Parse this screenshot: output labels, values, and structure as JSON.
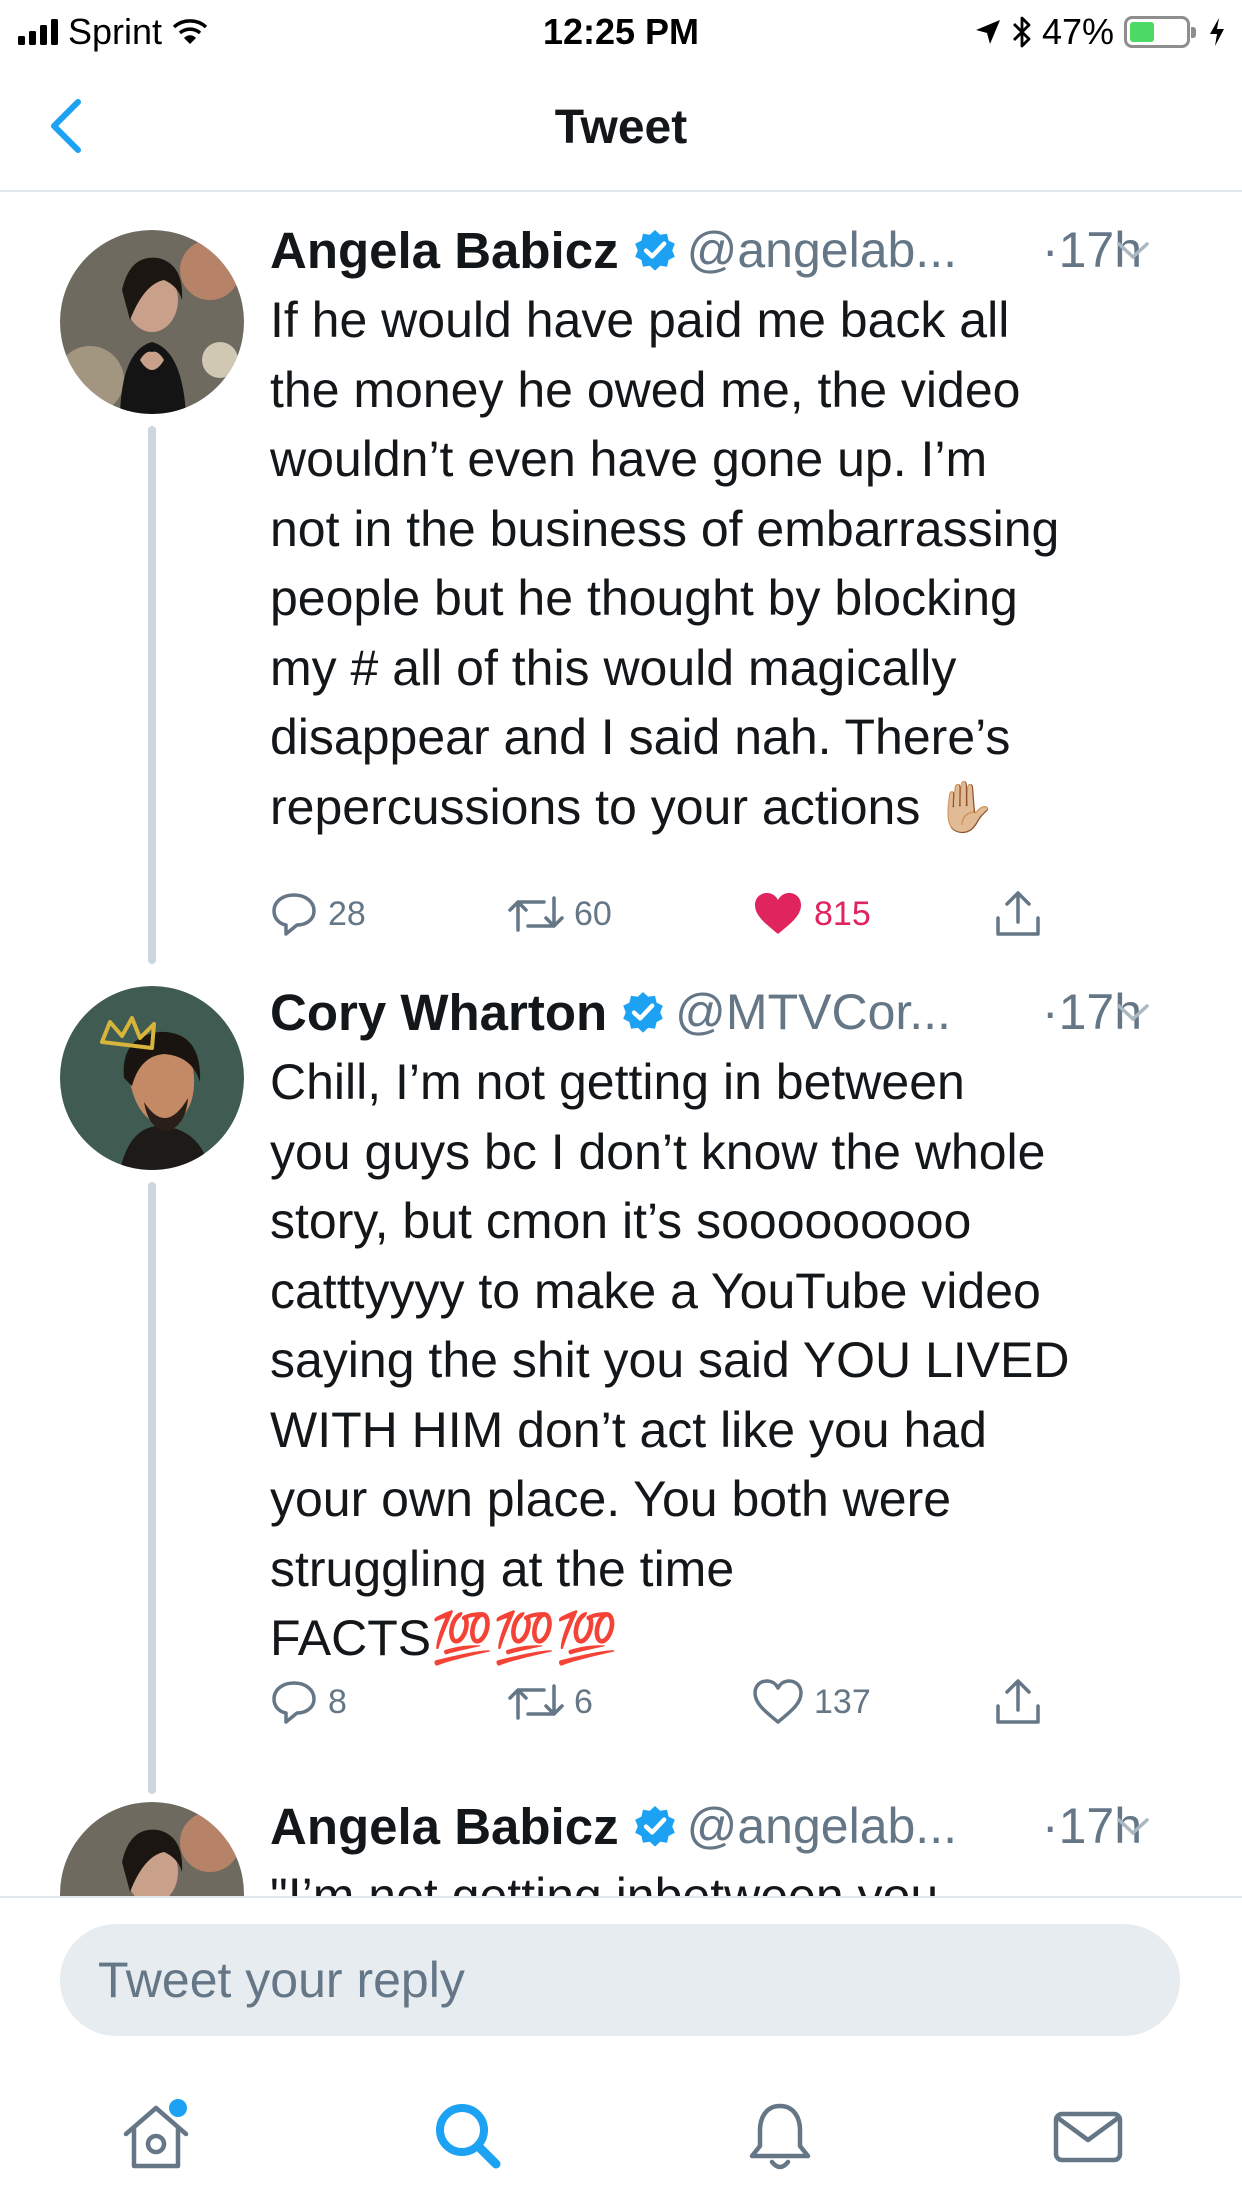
{
  "status_bar": {
    "carrier": "Sprint",
    "time": "12:25 PM",
    "battery_percent": "47%",
    "battery_level": 0.47
  },
  "nav": {
    "title": "Tweet",
    "back_icon": "chevron-left-icon"
  },
  "tweets": [
    {
      "name": "Angela Babicz",
      "handle": "@angelab...",
      "time": "·17h",
      "verified": true,
      "text": "If he would have paid me back all\nthe money he owed me, the video\nwouldn’t even have gone up. I’m\nnot in the business of embarrassing\npeople but he thought by blocking\nmy # all of this would magically\ndisappear and I said nah. There’s\nrepercussions to your actions ✋🏼",
      "replies": "28",
      "retweets": "60",
      "likes": "815",
      "liked": true
    },
    {
      "name": "Cory Wharton",
      "handle": "@MTVCor...",
      "time": "·17h",
      "verified": true,
      "text": "Chill, I’m not getting in between\nyou guys bc I don’t know the whole\nstory, but cmon it’s sooooooooo\ncatttyyyy to make a YouTube video\nsaying the shit you said YOU LIVED\nWITH HIM don’t act like you had\nyour own place. You both were\nstruggling at the time\nFACTS💯💯💯",
      "replies": "8",
      "retweets": "6",
      "likes": "137",
      "liked": false
    },
    {
      "name": "Angela Babicz",
      "handle": "@angelab...",
      "time": "·17h",
      "verified": true,
      "text": "\"I’m not getting inbetween you"
    }
  ],
  "reply": {
    "placeholder": "Tweet your reply"
  },
  "tab_bar": {
    "items": [
      "home-icon",
      "search-icon",
      "notifications-bell-icon",
      "messages-envelope-icon"
    ],
    "active": "search-icon"
  },
  "colors": {
    "accent": "#1da1f2",
    "like": "#e0245e",
    "secondary_text": "#657786",
    "battery": "#4cd964"
  }
}
